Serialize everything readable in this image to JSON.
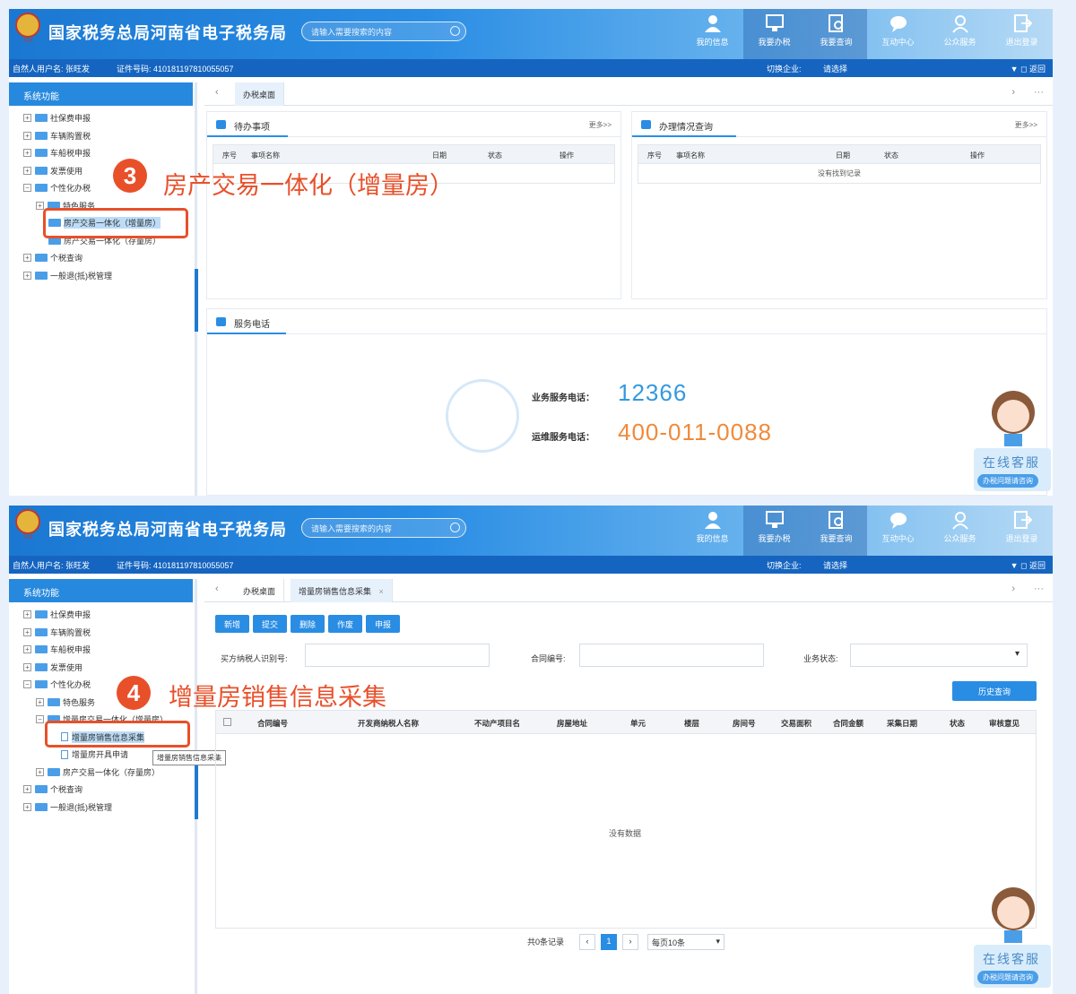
{
  "header": {
    "title": "国家税务总局河南省电子税务局",
    "emblem_text": "TAX",
    "search_placeholder": "请输入需要搜索的内容",
    "nav": [
      "我的信息",
      "我要办税",
      "我要查询",
      "互动中心",
      "公众服务",
      "退出登录"
    ]
  },
  "subbar": {
    "user": "自然人用户名: 张旺发",
    "cert": "证件号码: 410181197810055057",
    "switch_label": "切换企业:",
    "switch_value": "请选择",
    "return_label": "▼ ◻ 返回"
  },
  "sidebar": {
    "title": "系统功能",
    "tree1": [
      "社保费申报",
      "车辆购置税",
      "车船税申报",
      "发票使用",
      "个性化办税",
      "特色服务",
      "房产交易一体化（增量房）",
      "房产交易一体化（存量房）",
      "个税查询",
      "一般退(抵)税管理"
    ],
    "tree2": [
      "社保费申报",
      "车辆购置税",
      "车船税申报",
      "发票使用",
      "个性化办税",
      "特色服务",
      "增量房交易一体化（增量房）",
      "增量房销售信息采集",
      "增量房开具申请",
      "房产交易一体化（存量房）",
      "个税查询",
      "一般退(抵)税管理"
    ],
    "tooltip": "增量房销售信息采集"
  },
  "tabs1": [
    "办税桌面"
  ],
  "tabs2": [
    "办税桌面",
    "增量房销售信息采集"
  ],
  "tab_close": "×",
  "nav_arrows": {
    "left": "‹",
    "right": "›",
    "more": "···"
  },
  "todo": {
    "title": "待办事项",
    "more": "更多>>",
    "cols": [
      "序号",
      "事项名称",
      "日期",
      "状态",
      "操作"
    ]
  },
  "query": {
    "title": "办理情况查询",
    "more": "更多>>",
    "cols": [
      "序号",
      "事项名称",
      "日期",
      "状态",
      "操作"
    ],
    "empty": "没有找到记录"
  },
  "service": {
    "title": "服务电话",
    "biz_label": "业务服务电话：",
    "biz_value": "12366",
    "ops_label": "运维服务电话：",
    "ops_value": "400-011-0088"
  },
  "customer_service": {
    "line1": "在线客服",
    "line2": "办税问题请咨询"
  },
  "annotations": [
    {
      "num": "3",
      "text": "房产交易一体化（增量房）"
    },
    {
      "num": "4",
      "text": "增量房销售信息采集"
    }
  ],
  "form": {
    "buttons": [
      "新增",
      "提交",
      "删除",
      "作废",
      "申报"
    ],
    "field1": "买方纳税人识别号:",
    "field2": "合同编号:",
    "field3": "业务状态:",
    "select_caret": "▾",
    "history": "历史查询",
    "cols": [
      "合同编号",
      "开发商纳税人名称",
      "不动产项目名",
      "房屋地址",
      "单元",
      "楼层",
      "房间号",
      "交易面积",
      "合同金额",
      "采集日期",
      "状态",
      "审核意见"
    ],
    "nodata": "没有数据",
    "pager_total": "共0条记录",
    "pager_prev": "‹",
    "pager_page": "1",
    "pager_next": "›",
    "pager_size": "每页10条",
    "pager_caret": "▾"
  }
}
